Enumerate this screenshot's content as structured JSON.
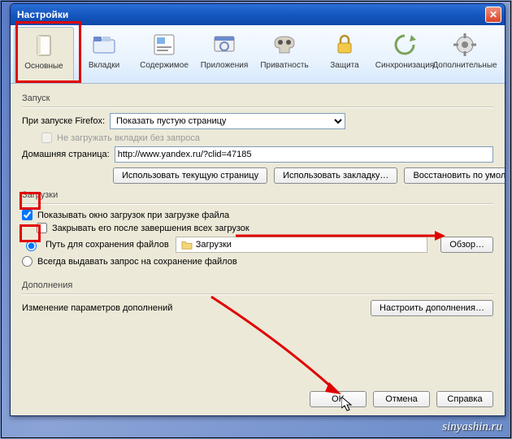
{
  "window": {
    "title": "Настройки"
  },
  "tabs": [
    {
      "label": "Основные"
    },
    {
      "label": "Вкладки"
    },
    {
      "label": "Содержимое"
    },
    {
      "label": "Приложения"
    },
    {
      "label": "Приватность"
    },
    {
      "label": "Защита"
    },
    {
      "label": "Синхронизация"
    },
    {
      "label": "Дополнительные"
    }
  ],
  "startup": {
    "section": "Запуск",
    "label": "При запуске Firefox:",
    "value": "Показать пустую страницу",
    "dont_load_tabs": "Не загружать вкладки без запроса",
    "homepage_label": "Домашняя страница:",
    "homepage_value": "http://www.yandex.ru/?clid=47185",
    "use_current": "Использовать текущую страницу",
    "use_bookmark": "Использовать закладку…",
    "restore_default": "Восстановить по умолчанию"
  },
  "downloads": {
    "section": "Загрузки",
    "show_window": "Показывать окно загрузок при загрузке файла",
    "close_after": "Закрывать его после завершения всех загрузок",
    "save_path": "Путь для сохранения файлов",
    "folder": "Загрузки",
    "browse": "Обзор…",
    "always_ask": "Всегда выдавать запрос на сохранение файлов"
  },
  "addons": {
    "section": "Дополнения",
    "desc": "Изменение параметров дополнений",
    "button": "Настроить дополнения…"
  },
  "buttons": {
    "ok": "OK",
    "cancel": "Отмена",
    "help": "Справка"
  },
  "watermark": "sinyashin.ru"
}
